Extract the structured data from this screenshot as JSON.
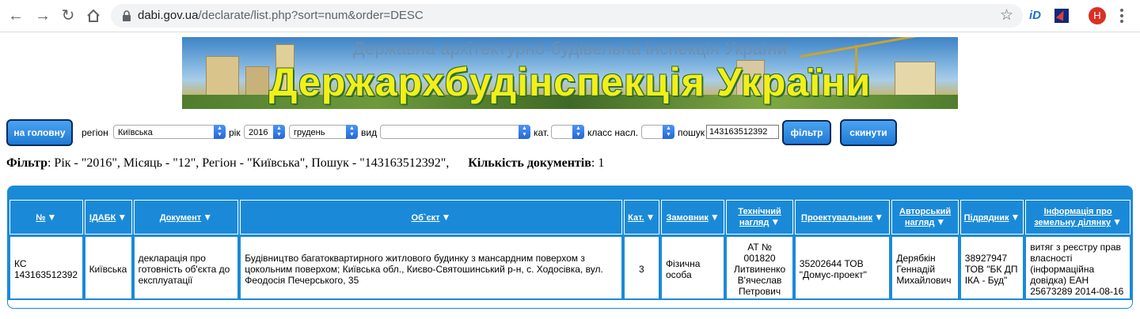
{
  "browser": {
    "url_host": "dabi.gov.ua",
    "url_path": "/declarate/list.php?sort=num&order=DESC",
    "avatar_letter": "H",
    "icons": [
      "back-arrow-icon",
      "forward-arrow-icon",
      "reload-icon",
      "home-icon",
      "lock-icon",
      "star-icon",
      "extension-id-icon",
      "extension-bolt-icon",
      "profile-avatar",
      "more-menu-icon"
    ]
  },
  "banner": {
    "subtitle": "Державна архітектурно-будівельна інспекція України",
    "title": "Держархбудінспекція України"
  },
  "filters": {
    "home_button": "на головну",
    "region_label": "регіон",
    "region_value": "Київська",
    "year_label": "рік",
    "year_value": "2016",
    "month_value": "грудень",
    "type_label": "вид",
    "type_value": "",
    "cat_label": "кат.",
    "cat_value": "",
    "class_label": "класс насл.",
    "class_value": "",
    "search_label": "пошук",
    "search_value": "143163512392",
    "filter_button": "фільтр",
    "reset_button": "скинути"
  },
  "summary": {
    "filter_label": "Фільтр",
    "filter_text": ": Рік - \"2016\", Місяць - \"12\", Регіон - \"Київська\", Пошук - \"143163512392\",",
    "count_label": "Кількість документів",
    "count_value": ": 1"
  },
  "table": {
    "headers": [
      "№",
      "ІДАБК",
      "Документ",
      "Об`єкт",
      "Кат.",
      "Замовник",
      "Технічний нагляд",
      "Проектувальник",
      "Авторський нагляд",
      "Підрядник",
      "Інформація про земельну ділянку"
    ],
    "sort_glyph": "▼",
    "rows": [
      {
        "num": "КС 143163512392",
        "idabk": "Київська",
        "document": "декларація про готовність об'єкта до експлуатації",
        "object": "Будівництво багатоквартирного житлового будинку з мансардним поверхом з цокольним поверхом; Київська обл., Києво-Святошинський р-н, с. Ходосівка, вул. Феодосія Печерського, 35",
        "cat": "3",
        "customer": "Фізична особа",
        "tech_supervision": "АТ № 001820 Литвиненко В'ячеслав Петрович",
        "designer": "35202644 ТОВ \"Домус-проект\"",
        "author_supervision": "Дерябкін Геннадій Михайлович",
        "contractor": "38927947 ТОВ \"БК ДП ІКА - Буд\"",
        "land_info": "витяг з реєстру прав власності (інформаційна довідка) ЕАН 25673289 2014-08-16"
      }
    ]
  },
  "colors": {
    "accent": "#1a8ad8",
    "button": "#1f7ad6",
    "banner_title": "#f2ef1a"
  }
}
